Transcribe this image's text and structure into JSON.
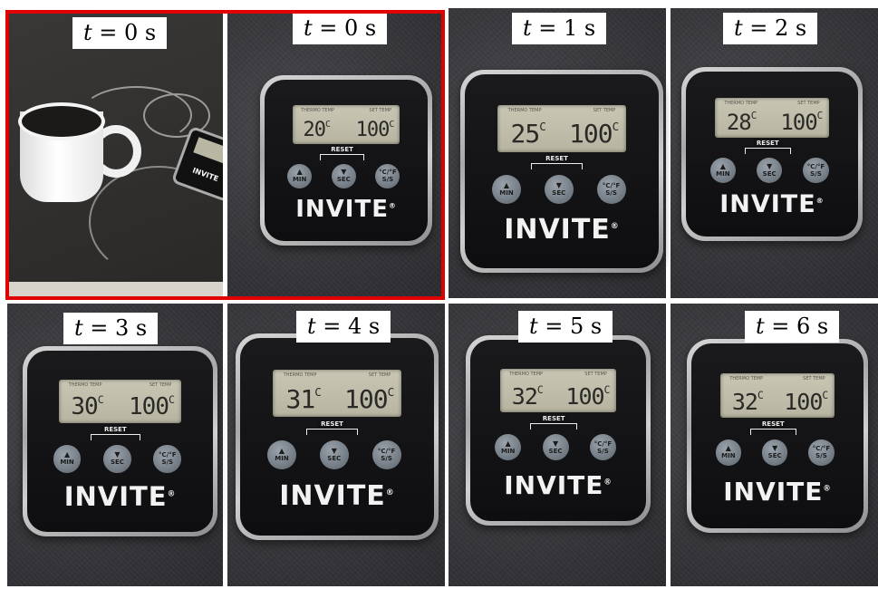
{
  "brand": "INVITE",
  "brand_mark": "®",
  "lcd_labels": {
    "left": "THERMO TEMP",
    "right": "SET TEMP"
  },
  "reset_label": "RESET",
  "buttons": {
    "min": "MIN",
    "sec": "SEC",
    "unit": "°C/°F",
    "unit2": "S/S"
  },
  "photo_brand": "INVITE",
  "frames": [
    {
      "t_var": "t",
      "t_rest": " = 0 s",
      "current": "20",
      "unit": "C",
      "set": "100"
    },
    {
      "t_var": "t",
      "t_rest": " = 0 s",
      "current": "20",
      "unit": "C",
      "set": "100"
    },
    {
      "t_var": "t",
      "t_rest": " = 1 s",
      "current": "25",
      "unit": "C",
      "set": "100"
    },
    {
      "t_var": "t",
      "t_rest": " = 2 s",
      "current": "28",
      "unit": "C",
      "set": "100"
    },
    {
      "t_var": "t",
      "t_rest": " = 3 s",
      "current": "30",
      "unit": "C",
      "set": "100"
    },
    {
      "t_var": "t",
      "t_rest": " = 4 s",
      "current": "31",
      "unit": "C",
      "set": "100"
    },
    {
      "t_var": "t",
      "t_rest": " = 5 s",
      "current": "32",
      "unit": "C",
      "set": "100"
    },
    {
      "t_var": "t",
      "t_rest": " = 6 s",
      "current": "32",
      "unit": "C",
      "set": "100"
    }
  ],
  "highlight_color": "#e00000"
}
